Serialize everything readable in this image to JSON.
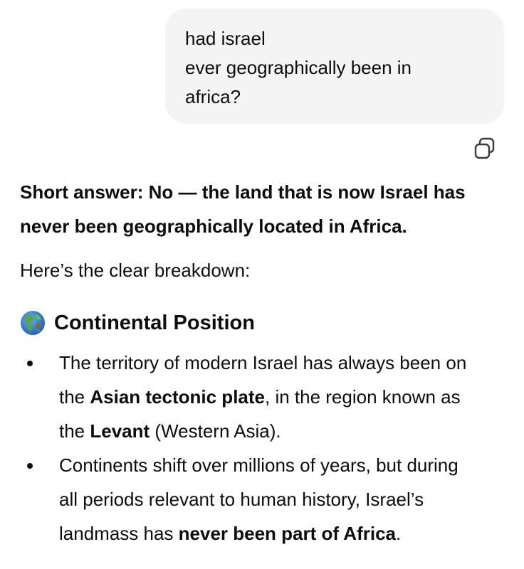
{
  "user_message": {
    "lines": [
      "had israel",
      "ever geographically been in",
      "africa?"
    ]
  },
  "copy_button": {
    "icon": "copy-icon"
  },
  "assistant": {
    "short_answer": {
      "line1": "Short answer: No — the land that is now Israel has",
      "line2": "never been geographically located in Africa."
    },
    "intro": "Here’s the clear breakdown:",
    "section": {
      "icon": "globe-icon",
      "heading": "Continental Position",
      "bullets": [
        {
          "l1": "The territory of modern Israel has always been on",
          "l2_pre": "the ",
          "l2_bold": "Asian tectonic plate",
          "l2_post": ", in the region known as",
          "l3_pre": "the ",
          "l3_bold": "Levant",
          "l3_post": " (Western Asia)."
        },
        {
          "l1": "Continents shift over millions of years, but during",
          "l2": "all periods relevant to human history, Israel’s",
          "l3_pre": "landmass has ",
          "l3_bold": "never been part of Africa",
          "l3_post": "."
        }
      ]
    }
  }
}
